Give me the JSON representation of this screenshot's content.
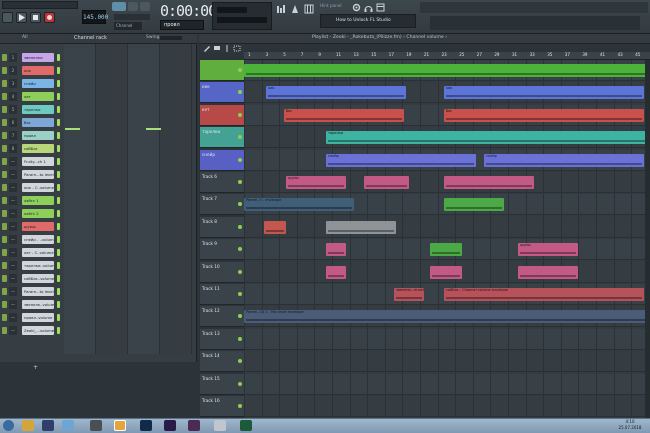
{
  "toolbar": {
    "tempo": "145.000",
    "time_display": "0:00:00",
    "time_sub": "M:S:CS",
    "pattern": "провл",
    "pattern_label": "Channel",
    "hint_label": "Hint panel",
    "hint_text": "How to Unlock FL Studio"
  },
  "rack": {
    "filter": "All",
    "title": "Channel rack",
    "swing_label": "Swing",
    "add_label": "+",
    "channels": [
      {
        "num": "1",
        "name": "звенелки",
        "color": "#c6a6e8"
      },
      {
        "num": "2",
        "name": "кик",
        "color": "#e06a6a"
      },
      {
        "num": "3",
        "name": "снейр",
        "color": "#7bb5e6"
      },
      {
        "num": "4",
        "name": "хат",
        "color": "#8ecf5c"
      },
      {
        "num": "5",
        "name": "тарелки",
        "color": "#6ec9c2"
      },
      {
        "num": "6",
        "name": "бас",
        "color": "#7ea6d6"
      },
      {
        "num": "7",
        "name": "провл",
        "color": "#9bd0c8"
      },
      {
        "num": "8",
        "name": "сабБас",
        "color": "#b9d77a"
      },
      {
        "num": "—",
        "name": "Fruity...ch 1",
        "color": "#d0d6da"
      },
      {
        "num": "—",
        "name": "Param...to level",
        "color": "#d0d6da"
      },
      {
        "num": "—",
        "name": "кик - С..volume",
        "color": "#d0d6da"
      },
      {
        "num": "—",
        "name": "хэйтс 1",
        "color": "#8ecf5c"
      },
      {
        "num": "—",
        "name": "хэйтс 2",
        "color": "#8ecf5c"
      },
      {
        "num": "—",
        "name": "шумы",
        "color": "#e06a6a"
      },
      {
        "num": "—",
        "name": "снейр - ..volume",
        "color": "#d0d6da"
      },
      {
        "num": "—",
        "name": "хат - С..volume",
        "color": "#d0d6da"
      },
      {
        "num": "—",
        "name": "тарелки..volume",
        "color": "#d0d6da"
      },
      {
        "num": "—",
        "name": "сабБас..volume",
        "color": "#d0d6da"
      },
      {
        "num": "—",
        "name": "Param...to level",
        "color": "#d0d6da"
      },
      {
        "num": "—",
        "name": "звенелк..volume",
        "color": "#d0d6da"
      },
      {
        "num": "—",
        "name": "провл..volume",
        "color": "#d0d6da"
      },
      {
        "num": "—",
        "name": "Zeoki_...volume",
        "color": "#d0d6da"
      }
    ]
  },
  "playlist": {
    "title": "Playlist - Zeoki - _Rokebuta_(Pilizze.fm) › Channel volume ›",
    "ruler": [
      "1",
      "3",
      "5",
      "7",
      "9",
      "11",
      "13",
      "15",
      "17",
      "19",
      "21",
      "23",
      "25",
      "27",
      "29",
      "31",
      "33",
      "35",
      "37",
      "39",
      "41",
      "43",
      "45"
    ],
    "tracks": [
      {
        "name": "",
        "color": "#5fae3e"
      },
      {
        "name": "кик",
        "color": "#5566c6"
      },
      {
        "name": "кет",
        "color": "#b74a48"
      },
      {
        "name": "тарелки",
        "color": "#43a293"
      },
      {
        "name": "снейр",
        "color": "#5960c4"
      },
      {
        "name": "Track 6",
        "color": "#3a4349"
      },
      {
        "name": "Track 7",
        "color": "#3a4349"
      },
      {
        "name": "Track 8",
        "color": "#3a4349"
      },
      {
        "name": "Track 9",
        "color": "#3a4349"
      },
      {
        "name": "Track 10",
        "color": "#3a4349"
      },
      {
        "name": "Track 11",
        "color": "#3a4349"
      },
      {
        "name": "Track 12",
        "color": "#3a4349"
      },
      {
        "name": "Track 13",
        "color": "#3a4349"
      },
      {
        "name": "Track 14",
        "color": "#3a4349"
      },
      {
        "name": "Track 15",
        "color": "#3a4349"
      },
      {
        "name": "Track 16",
        "color": "#3a4349"
      }
    ],
    "clips": {
      "shumy": "шумы",
      "param_env": "Param...t - envelope",
      "param_dj": "Param...DJ 2 - Mix level envelope",
      "chvol": "сабБас - Channel volume envelope",
      "zvenelk": "звенелк...envelope",
      "kick": "кик",
      "bas": "бас",
      "snare": "снейр",
      "tarel": "тарелки"
    }
  },
  "taskbar": {
    "time": "4:10",
    "date": "25.07.2018"
  }
}
